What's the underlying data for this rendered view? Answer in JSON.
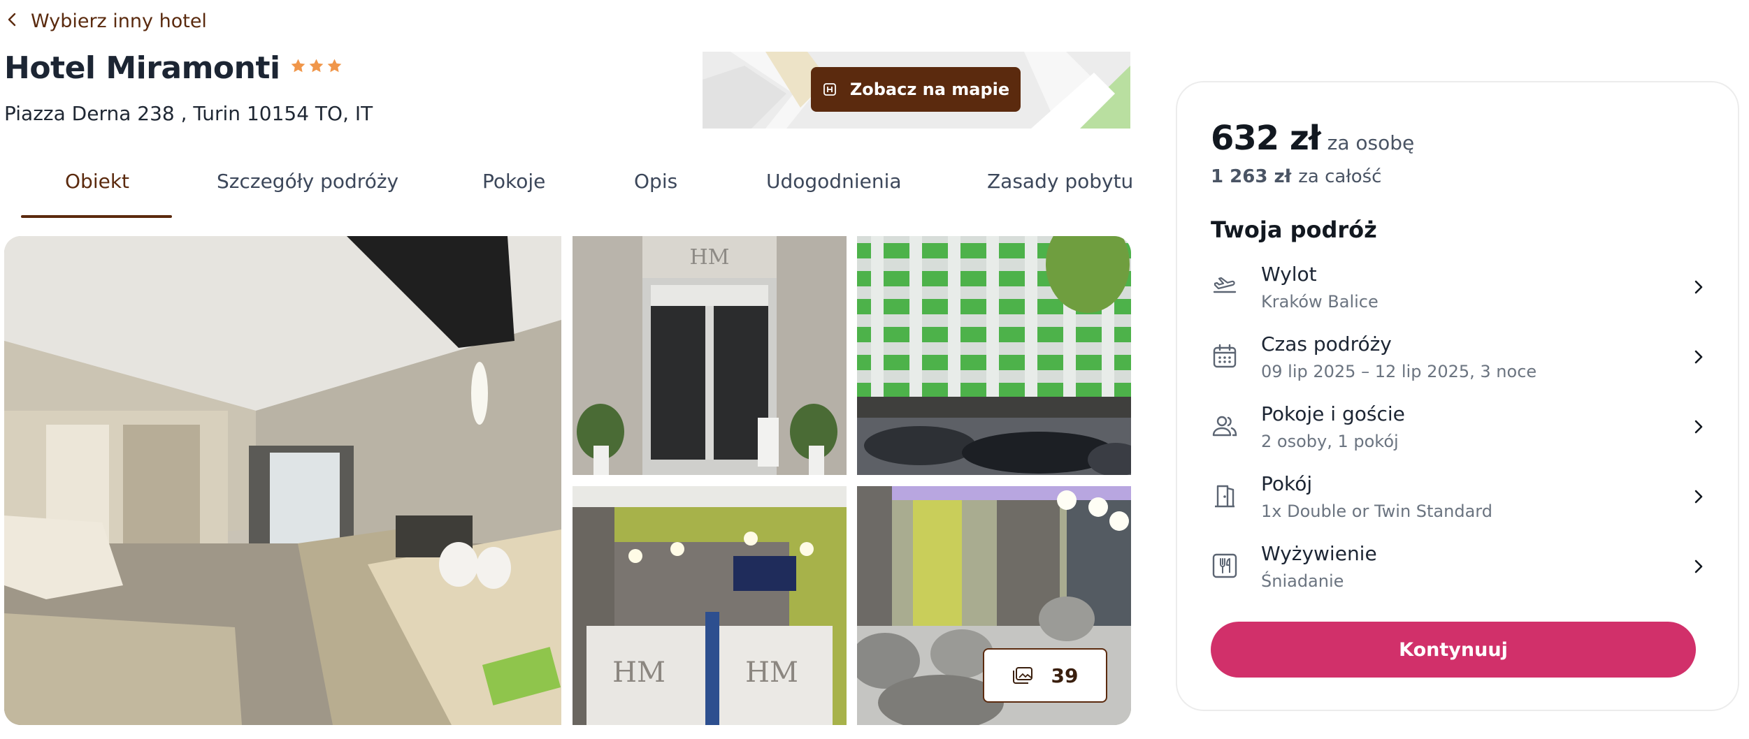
{
  "nav": {
    "back_label": "Wybierz inny hotel"
  },
  "hotel": {
    "name": "Hotel Miramonti",
    "stars": 3,
    "address": "Piazza Derna 238 , Turin 10154 TO, IT"
  },
  "map": {
    "button_label": "Zobacz na mapie"
  },
  "tabs": [
    {
      "label": "Obiekt",
      "active": true
    },
    {
      "label": "Szczegóły podróży",
      "active": false
    },
    {
      "label": "Pokoje",
      "active": false
    },
    {
      "label": "Opis",
      "active": false
    },
    {
      "label": "Udogodnienia",
      "active": false
    },
    {
      "label": "Zasady pobytu",
      "active": false
    }
  ],
  "gallery": {
    "photo_count": "39"
  },
  "booking": {
    "price": "632 zł",
    "price_unit": "za osobę",
    "total": "1 263 zł",
    "total_unit": "za całość",
    "trip_title": "Twoja podróż",
    "items": [
      {
        "label": "Wylot",
        "value": "Kraków Balice",
        "icon": "plane-departure-icon"
      },
      {
        "label": "Czas podróży",
        "value": "09 lip 2025 – 12 lip 2025, 3 noce",
        "icon": "calendar-icon"
      },
      {
        "label": "Pokoje i goście",
        "value": "2 osoby, 1 pokój",
        "icon": "guests-icon"
      },
      {
        "label": "Pokój",
        "value": "1x Double or Twin Standard",
        "icon": "door-icon"
      },
      {
        "label": "Wyżywienie",
        "value": "Śniadanie",
        "icon": "cutlery-icon"
      }
    ],
    "cta_label": "Kontynuuj"
  },
  "colors": {
    "brand_brown": "#5b2a0e",
    "cta_pink": "#d1306a",
    "star_orange": "#f0964a"
  }
}
